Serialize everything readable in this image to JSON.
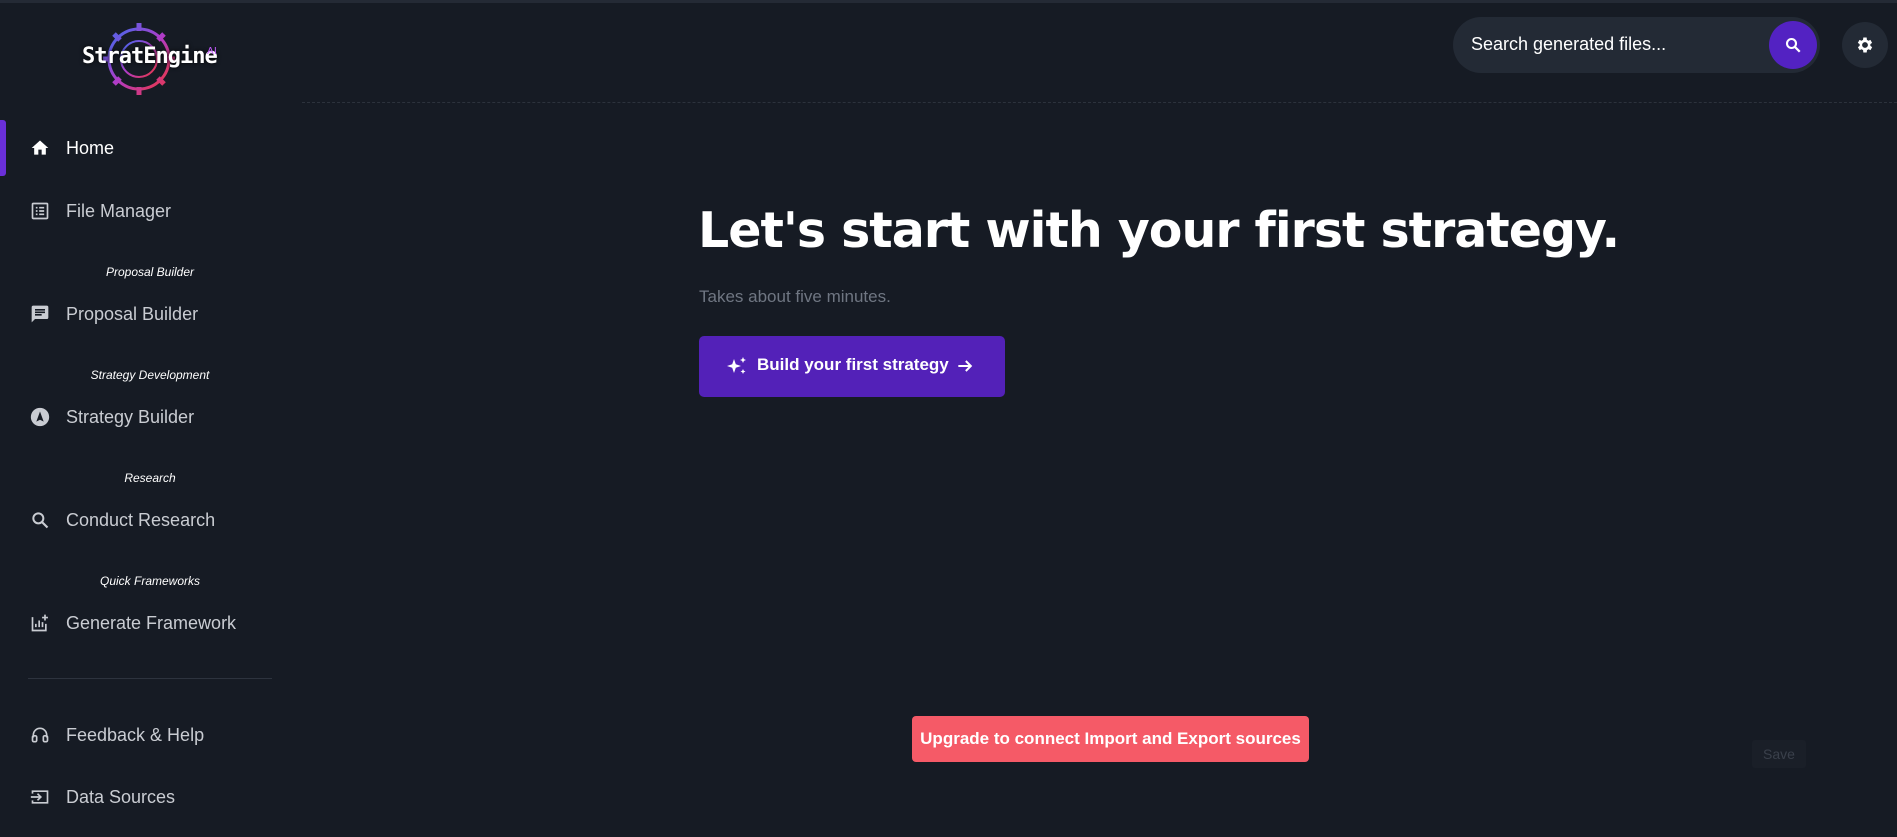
{
  "app": {
    "logo_text": "StratEngine",
    "logo_sup": "AI",
    "accent_color": "#5321b8",
    "upgrade_color": "#f55a67"
  },
  "sidebar": {
    "items": [
      {
        "label": "Home",
        "icon": "home-icon"
      },
      {
        "label": "File Manager",
        "icon": "list-icon"
      },
      {
        "label": "Proposal Builder",
        "icon": "chat-icon"
      },
      {
        "label": "Strategy Builder",
        "icon": "compass-icon"
      },
      {
        "label": "Conduct Research",
        "icon": "search-icon"
      },
      {
        "label": "Generate Framework",
        "icon": "chart-add-icon"
      },
      {
        "label": "Feedback & Help",
        "icon": "headset-icon"
      },
      {
        "label": "Data Sources",
        "icon": "input-icon"
      }
    ],
    "sections": {
      "proposal": "Proposal Builder",
      "strategy": "Strategy Development",
      "research": "Research",
      "frameworks": "Quick Frameworks"
    }
  },
  "header": {
    "search_placeholder": "Search generated files..."
  },
  "main": {
    "headline": "Let's start with your first strategy.",
    "subtitle": "Takes about five minutes.",
    "cta_label": "Build your first strategy",
    "upgrade_label": "Upgrade to connect Import and Export sources",
    "save_label": "Save"
  }
}
